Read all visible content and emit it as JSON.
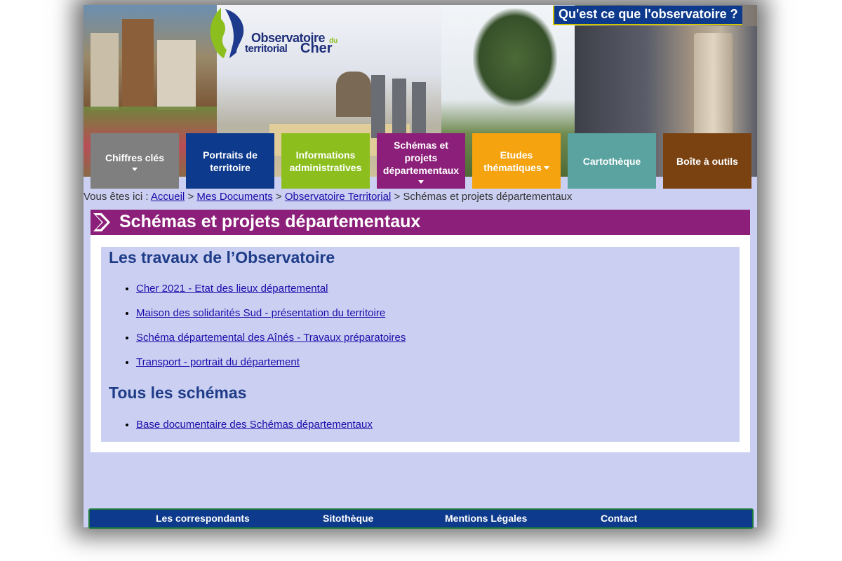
{
  "header": {
    "logo": {
      "line1": "Observatoire",
      "line2": "territorial",
      "line3": "Cher",
      "line4": "du"
    },
    "about_button": "Qu'est ce que l'observatoire ?"
  },
  "nav": [
    {
      "label": "Chiffres clés",
      "color": "#7f7f7f",
      "dropdown": true
    },
    {
      "label": "Portraits de territoire",
      "color": "#0d3a8c",
      "dropdown": false
    },
    {
      "label": "Informations administratives",
      "color": "#8cbf1e",
      "dropdown": false
    },
    {
      "label": "Schémas et projets départementaux",
      "color": "#8c1f79",
      "dropdown": true
    },
    {
      "label": "Etudes thématiques",
      "color": "#f5a30f",
      "dropdown": true
    },
    {
      "label": "Cartothèque",
      "color": "#5aa3a0",
      "dropdown": false
    },
    {
      "label": "Boîte à outils",
      "color": "#7a4211",
      "dropdown": false
    }
  ],
  "breadcrumb": {
    "prefix": "Vous êtes ici :",
    "links": [
      "Accueil",
      "Mes Documents",
      "Observatoire Territorial"
    ],
    "separator": ">",
    "current": "Schémas et projets départementaux"
  },
  "page": {
    "title": "Schémas et projets départementaux",
    "sections": [
      {
        "heading": "Les travaux de l’Observatoire",
        "links": [
          "Cher 2021 - Etat des lieux départemental",
          "Maison des solidarités Sud - présentation du territoire",
          "Schéma départemental des Aînés - Travaux préparatoires",
          "Transport - portrait du département"
        ]
      },
      {
        "heading": "Tous les schémas",
        "links": [
          "Base documentaire des Schémas départementaux"
        ]
      }
    ]
  },
  "footer": {
    "links": [
      "Les correspondants",
      "Sitothèque",
      "Mentions Légales",
      "Contact"
    ]
  }
}
